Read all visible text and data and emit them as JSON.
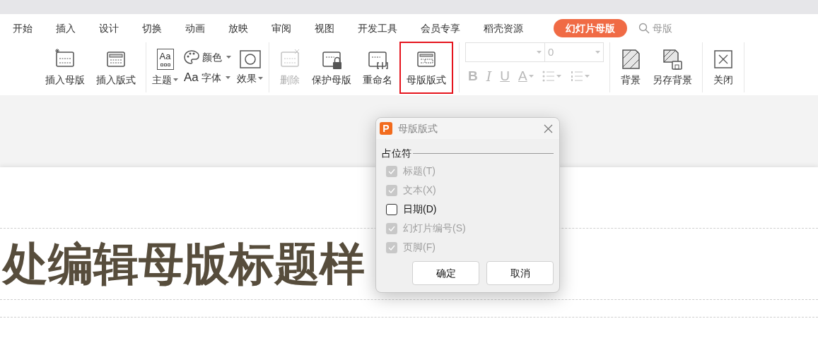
{
  "tabs": [
    {
      "label": "开始",
      "selected": false
    },
    {
      "label": "插入",
      "selected": false
    },
    {
      "label": "设计",
      "selected": false
    },
    {
      "label": "切换",
      "selected": false
    },
    {
      "label": "动画",
      "selected": false
    },
    {
      "label": "放映",
      "selected": false
    },
    {
      "label": "审阅",
      "selected": false
    },
    {
      "label": "视图",
      "selected": false
    },
    {
      "label": "开发工具",
      "selected": false
    },
    {
      "label": "会员专享",
      "selected": false
    },
    {
      "label": "稻壳资源",
      "selected": false
    },
    {
      "label": "幻灯片母版",
      "selected": true
    }
  ],
  "search": {
    "label": "母版"
  },
  "ribbon": [
    {
      "kind": "large",
      "items": [
        {
          "label": "插入母版",
          "disabled": false,
          "highlighted": false
        },
        {
          "label": "插入版式",
          "disabled": false,
          "highlighted": false
        }
      ]
    },
    {
      "kind": "theme",
      "theme": {
        "label": "主题",
        "icon_text": "Aa"
      },
      "color": {
        "label": "颜色"
      },
      "font": {
        "label": "字体",
        "icon_text": "Aa"
      },
      "effect": {
        "label": "效果"
      }
    },
    {
      "kind": "large",
      "items": [
        {
          "label": "删除",
          "disabled": true,
          "highlighted": false
        },
        {
          "label": "保护母版",
          "disabled": false,
          "highlighted": false
        },
        {
          "label": "重命名",
          "disabled": false,
          "highlighted": false
        },
        {
          "label": "母版版式",
          "disabled": false,
          "highlighted": true
        }
      ]
    },
    {
      "kind": "font",
      "disabled": true,
      "size": "0",
      "glyphs": [
        "B",
        "I",
        "U",
        "A"
      ]
    },
    {
      "kind": "large",
      "items": [
        {
          "label": "背景",
          "disabled": false,
          "highlighted": false
        },
        {
          "label": "另存背景",
          "disabled": false,
          "highlighted": false
        }
      ]
    },
    {
      "kind": "large",
      "items": [
        {
          "label": "关闭",
          "disabled": false,
          "highlighted": false
        }
      ]
    }
  ],
  "slide": {
    "title": "处编辑母版标题样"
  },
  "dialog": {
    "logo_text": "P",
    "title": "母版版式",
    "section": "占位符",
    "placeholders": [
      {
        "label": "标题(T)",
        "checked": true,
        "disabled": true
      },
      {
        "label": "文本(X)",
        "checked": true,
        "disabled": true
      },
      {
        "label": "日期(D)",
        "checked": false,
        "disabled": false
      },
      {
        "label": "幻灯片编号(S)",
        "checked": true,
        "disabled": true
      },
      {
        "label": "页脚(F)",
        "checked": true,
        "disabled": true
      }
    ],
    "buttons": [
      "确定",
      "取消"
    ]
  }
}
